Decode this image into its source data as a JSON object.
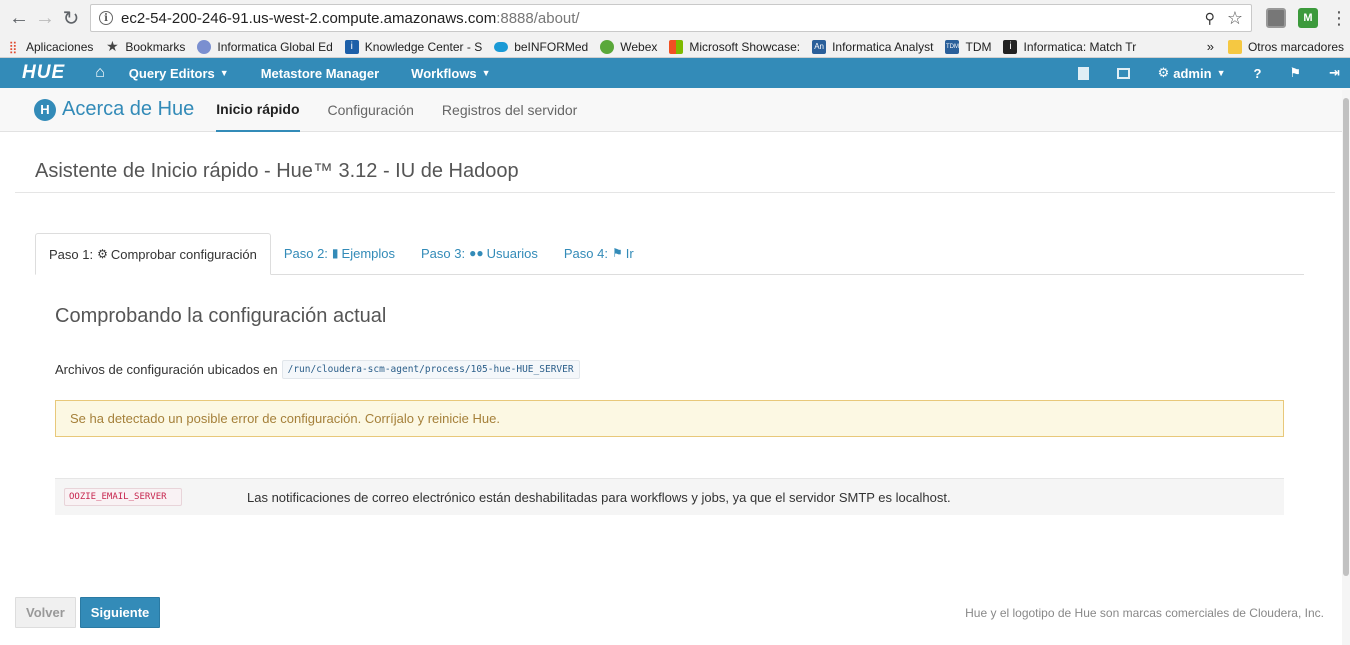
{
  "browser": {
    "url_host": "ec2-54-200-246-91.us-west-2.compute.amazonaws.com",
    "url_path": ":8888/about/",
    "back": "←",
    "forward": "→",
    "reload": "↻",
    "ext2_label": "M",
    "menu": "⋮"
  },
  "bookmarks": [
    {
      "label": "Aplicaciones",
      "icon": "apps-icon",
      "color": "#e04a2f"
    },
    {
      "label": "Bookmarks",
      "icon": "star-icon",
      "color": "#444444"
    },
    {
      "label": "Informatica Global Ed",
      "icon": "globe-icon",
      "color": "#5b7bd5"
    },
    {
      "label": "Knowledge Center - S",
      "icon": "info-icon",
      "color": "#1d5fa8"
    },
    {
      "label": "beINFORMed",
      "icon": "cloud-icon",
      "color": "#1a9ad6"
    },
    {
      "label": "Webex",
      "icon": "ball-icon",
      "color": "#5aa83a"
    },
    {
      "label": "Microsoft Showcase:",
      "icon": "windows-icon",
      "color": "#d83b01"
    },
    {
      "label": "Informatica Analyst",
      "icon": "an-icon",
      "color": "#2a5f9a"
    },
    {
      "label": "TDM",
      "icon": "tdm-icon",
      "color": "#2a5f9a"
    },
    {
      "label": "Informatica: Match Tr",
      "icon": "i-icon",
      "color": "#222222"
    }
  ],
  "bookmarks_overflow": "»",
  "bookmarks_other": "Otros marcadores",
  "hue_nav": {
    "logo": "HUE",
    "query_editors": "Query Editors",
    "metastore": "Metastore Manager",
    "workflows": "Workflows",
    "admin": "admin"
  },
  "subnav": {
    "title": "Acerca de Hue",
    "tabs": [
      "Inicio rápido",
      "Configuración",
      "Registros del servidor"
    ]
  },
  "page": {
    "heading": "Asistente de Inicio rápido - Hue™ 3.12 - IU de Hadoop",
    "steps": [
      {
        "prefix": "Paso 1:",
        "label": "Comprobar configuración"
      },
      {
        "prefix": "Paso 2:",
        "label": "Ejemplos"
      },
      {
        "prefix": "Paso 3:",
        "label": "Usuarios"
      },
      {
        "prefix": "Paso 4:",
        "label": "Ir"
      }
    ],
    "pane_title": "Comprobando la configuración actual",
    "config_text": "Archivos de configuración ubicados en",
    "config_path": "/run/cloudera-scm-agent/process/105-hue-HUE_SERVER",
    "alert": "Se ha detectado un posible error de configuración. Corríjalo y reinicie Hue.",
    "warning": {
      "code": "OOZIE_EMAIL_SERVER",
      "message": "Las notificaciones de correo electrónico están deshabilitadas para workflows y jobs, ya que el servidor SMTP es localhost."
    },
    "btn_back": "Volver",
    "btn_next": "Siguiente",
    "footer_note": "Hue y el logotipo de Hue son marcas comerciales de Cloudera, Inc."
  },
  "colors": {
    "hue_blue": "#338bb8",
    "alert_bg": "#fcf8e3",
    "alert_text": "#a5803a",
    "code_red": "#c7254e"
  }
}
